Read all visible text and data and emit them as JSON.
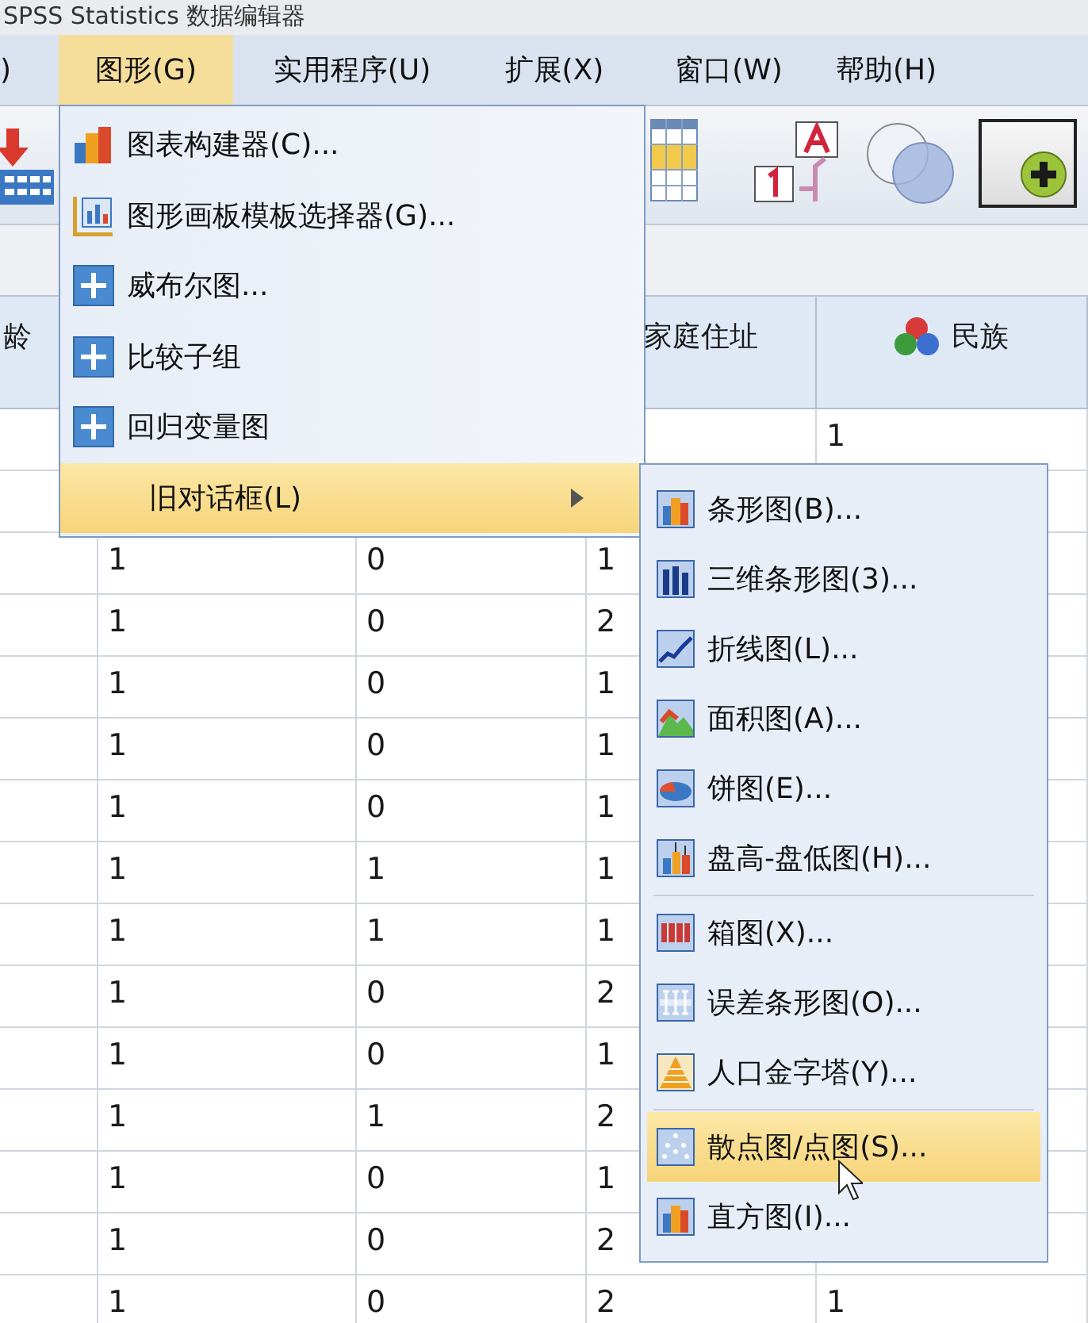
{
  "window": {
    "title": "SPSS Statistics 数据编辑器"
  },
  "menu_bar": [
    {
      "label": ")",
      "selected": false
    },
    {
      "label": "图形(G)",
      "selected": true
    },
    {
      "label": "实用程序(U)",
      "selected": false
    },
    {
      "label": "扩展(X)",
      "selected": false
    },
    {
      "label": "窗口(W)",
      "selected": false
    },
    {
      "label": "帮助(H)",
      "selected": false
    }
  ],
  "graphs_menu": [
    {
      "label": "图表构建器(C)...",
      "kind": "builder",
      "selected": false,
      "submenu": false
    },
    {
      "label": "图形画板模板选择器(G)...",
      "kind": "template",
      "selected": false,
      "submenu": false
    },
    {
      "label": "威布尔图...",
      "kind": "plus",
      "selected": false,
      "submenu": false
    },
    {
      "label": "比较子组",
      "kind": "plus",
      "selected": false,
      "submenu": false
    },
    {
      "label": "回归变量图",
      "kind": "plus",
      "selected": false,
      "submenu": false
    },
    {
      "label": "旧对话框(L)",
      "kind": "none",
      "selected": true,
      "submenu": true
    }
  ],
  "legacy_dialogs_menu": [
    {
      "label": "条形图(B)...",
      "kind": "bar",
      "selected": false,
      "separator_after": false
    },
    {
      "label": "三维条形图(3)...",
      "kind": "bar3d",
      "selected": false,
      "separator_after": false
    },
    {
      "label": "折线图(L)...",
      "kind": "line",
      "selected": false,
      "separator_after": false
    },
    {
      "label": "面积图(A)...",
      "kind": "area",
      "selected": false,
      "separator_after": false
    },
    {
      "label": "饼图(E)...",
      "kind": "pie",
      "selected": false,
      "separator_after": false
    },
    {
      "label": "盘高-盘低图(H)...",
      "kind": "hilo",
      "selected": false,
      "separator_after": true
    },
    {
      "label": "箱图(X)...",
      "kind": "box",
      "selected": false,
      "separator_after": false
    },
    {
      "label": "误差条形图(O)...",
      "kind": "errorbar",
      "selected": false,
      "separator_after": false
    },
    {
      "label": "人口金字塔(Y)...",
      "kind": "pyramid",
      "selected": false,
      "separator_after": true
    },
    {
      "label": "散点图/点图(S)...",
      "kind": "scatter",
      "selected": true,
      "separator_after": false
    },
    {
      "label": "直方图(I)...",
      "kind": "histogram",
      "selected": false,
      "separator_after": false
    }
  ],
  "table": {
    "columns": [
      "龄",
      null,
      null,
      "家庭住址",
      "民族"
    ],
    "rows": [
      [
        null,
        null,
        null,
        null,
        "1"
      ],
      [
        null,
        null,
        null,
        null,
        null
      ],
      [
        null,
        "1",
        "0",
        "1",
        null
      ],
      [
        null,
        "1",
        "0",
        "2",
        null
      ],
      [
        null,
        "1",
        "0",
        "1",
        null
      ],
      [
        null,
        "1",
        "0",
        "1",
        null
      ],
      [
        null,
        "1",
        "0",
        "1",
        null
      ],
      [
        null,
        "1",
        "1",
        "1",
        null
      ],
      [
        null,
        "1",
        "1",
        "1",
        null
      ],
      [
        null,
        "1",
        "0",
        "2",
        null
      ],
      [
        null,
        "1",
        "0",
        "1",
        null
      ],
      [
        null,
        "1",
        "1",
        "2",
        null
      ],
      [
        null,
        "1",
        "0",
        "1",
        null
      ],
      [
        null,
        "1",
        "0",
        "2",
        null
      ],
      [
        null,
        "1",
        "0",
        "2",
        "1"
      ]
    ]
  }
}
